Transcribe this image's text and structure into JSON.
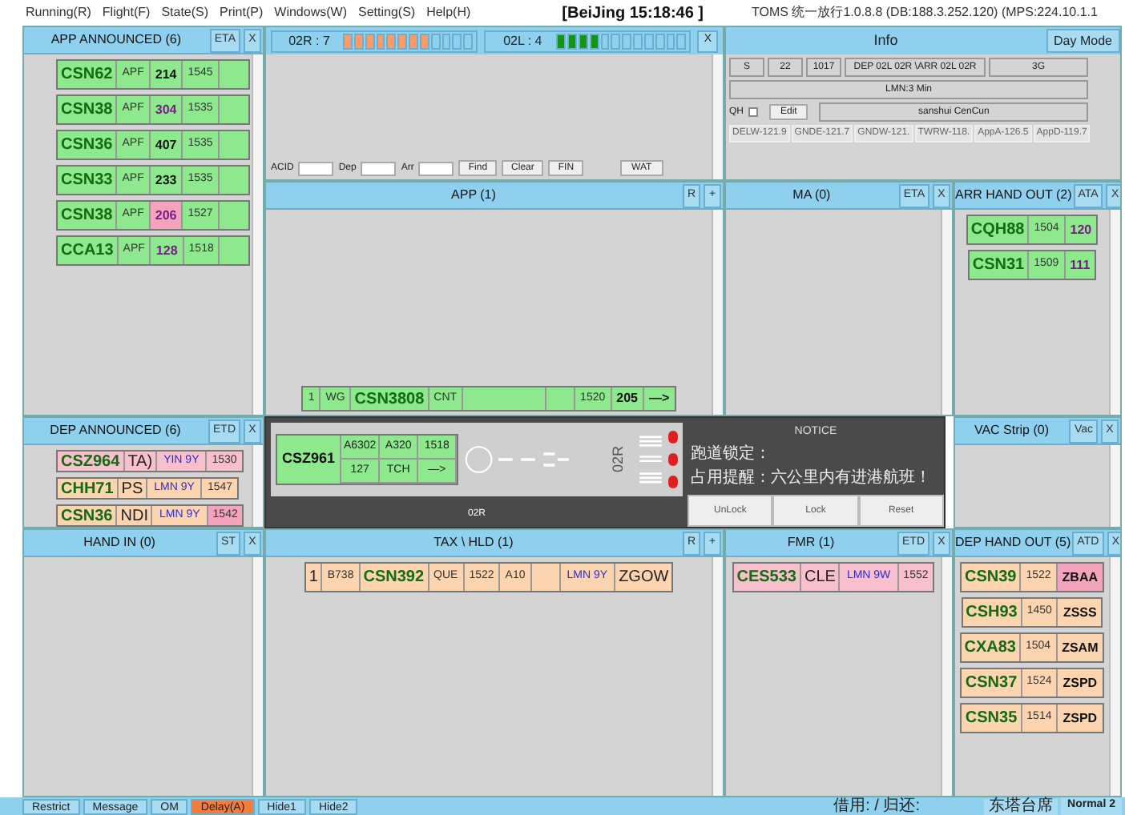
{
  "menu": [
    "Running(R)",
    "Flight(F)",
    "State(S)",
    "Print(P)",
    "Windows(W)",
    "Setting(S)",
    "Help(H)"
  ],
  "clock": "[BeiJing 15:18:46 ]",
  "version": "TOMS 统一放行1.0.8.8 (DB:188.3.252.120) (MPS:224.10.1.1",
  "app_announced": {
    "title": "APP ANNOUNCED (6)",
    "buttons": [
      "ETA",
      "X"
    ],
    "strips": [
      {
        "color": "#8ee88e",
        "cells": [
          {
            "text": "CSN62",
            "kind": "callsign"
          },
          {
            "text": "APF",
            "kind": "plain"
          },
          {
            "text": "214",
            "kind": "bold"
          },
          {
            "text": "1545",
            "kind": "plain"
          },
          {
            "kind": "gap"
          }
        ]
      },
      {
        "color": "#8ee88e",
        "cells": [
          {
            "text": "CSN38",
            "kind": "callsign"
          },
          {
            "text": "APF",
            "kind": "plain"
          },
          {
            "text": "304",
            "kind": "purple"
          },
          {
            "text": "1535",
            "kind": "plain"
          },
          {
            "kind": "gap"
          }
        ]
      },
      {
        "color": "#8ee88e",
        "cells": [
          {
            "text": "CSN36",
            "kind": "callsign"
          },
          {
            "text": "APF",
            "kind": "plain"
          },
          {
            "text": "407",
            "kind": "bold"
          },
          {
            "text": "1535",
            "kind": "plain"
          },
          {
            "kind": "gap"
          }
        ]
      },
      {
        "color": "#8ee88e",
        "cells": [
          {
            "text": "CSN33",
            "kind": "callsign"
          },
          {
            "text": "APF",
            "kind": "plain"
          },
          {
            "text": "233",
            "kind": "bold"
          },
          {
            "text": "1535",
            "kind": "plain"
          },
          {
            "kind": "gap"
          }
        ]
      },
      {
        "color": "#8ee88e",
        "cells": [
          {
            "text": "CSN38",
            "kind": "callsign"
          },
          {
            "text": "APF",
            "kind": "plain"
          },
          {
            "text": "206",
            "kind": "purple",
            "highlight": true
          },
          {
            "text": "1527",
            "kind": "plain"
          },
          {
            "kind": "gap"
          }
        ]
      },
      {
        "color": "#8ee88e",
        "cells": [
          {
            "text": "CCA13",
            "kind": "callsign"
          },
          {
            "text": "APF",
            "kind": "plain"
          },
          {
            "text": "128",
            "kind": "purple"
          },
          {
            "text": "1518",
            "kind": "plain"
          },
          {
            "kind": "gap"
          }
        ]
      }
    ]
  },
  "runways": [
    {
      "label": "02R : 7",
      "level": 0.636,
      "color": "#ff9966"
    },
    {
      "label": "02L : 4",
      "level": 0.308,
      "color": "#129612"
    }
  ],
  "runway_close": "X",
  "search": {
    "fields": [
      {
        "label": "ACID"
      },
      {
        "label": "Dep"
      },
      {
        "label": "Arr"
      }
    ],
    "buttons": [
      "Find",
      "Clear",
      "FIN"
    ],
    "extra_button": "WAT"
  },
  "info": {
    "title": "Info",
    "mode_button": "Day Mode",
    "values": [
      "S",
      "22",
      "1017",
      "DEP 02L 02R \\ARR 02L 02R",
      "3G"
    ],
    "notice": "LMN:3 Min",
    "qh_label": "QH",
    "qh_checked": false,
    "edit": "Edit",
    "location": "sanshui CenCun",
    "frequencies": [
      "DELW-121.9",
      "GNDE-121.7",
      "GNDW-121.",
      "TWRW-118.",
      "AppA-126.5",
      "AppD-119.7"
    ]
  },
  "app": {
    "title": "APP (1)",
    "buttons": [
      "R",
      "+"
    ],
    "strips": [
      {
        "color": "#8ee88e",
        "cells": [
          {
            "text": "1",
            "kind": "plain"
          },
          {
            "text": "WG",
            "kind": "plain"
          },
          {
            "text": "CSN3808",
            "kind": "callsign"
          },
          {
            "text": "CNT",
            "kind": "plain"
          },
          {
            "kind": "wide"
          },
          {
            "kind": "gap"
          },
          {
            "text": "1520",
            "kind": "plain"
          },
          {
            "text": "205",
            "kind": "bold"
          },
          {
            "text": "—>",
            "kind": "bold"
          }
        ]
      }
    ]
  },
  "ma": {
    "title": "MA (0)",
    "buttons": [
      "ETA",
      "X"
    ]
  },
  "arr_hand_out": {
    "title": "ARR HAND OUT (2)",
    "buttons": [
      "ATA",
      "X"
    ],
    "strips": [
      {
        "color": "#8ee88e",
        "cells": [
          {
            "text": "CQH88",
            "kind": "callsign"
          },
          {
            "text": "1504",
            "kind": "plain"
          },
          {
            "text": "120",
            "kind": "purple"
          }
        ]
      },
      {
        "color": "#8ee88e",
        "cells": [
          {
            "text": "CSN31",
            "kind": "callsign"
          },
          {
            "text": "1509",
            "kind": "plain"
          },
          {
            "text": "111",
            "kind": "purple"
          }
        ]
      }
    ]
  },
  "dep_announced": {
    "title": "DEP ANNOUNCED (6)",
    "buttons": [
      "ETD",
      "X"
    ],
    "strips": [
      {
        "color": "#f7c0cc",
        "cells": [
          {
            "text": "CSZ964",
            "kind": "callsign"
          },
          {
            "text": "TA)",
            "kind": "large"
          },
          {
            "text": "YIN 9Y",
            "kind": "blue"
          },
          {
            "text": "1530",
            "kind": "plain"
          }
        ]
      },
      {
        "color": "#fcd5b0",
        "cells": [
          {
            "text": "CHH71",
            "kind": "callsign"
          },
          {
            "text": "PS",
            "kind": "large"
          },
          {
            "text": "LMN 9Y",
            "kind": "blue"
          },
          {
            "text": "1547",
            "kind": "plain"
          }
        ]
      },
      {
        "color": "#fcd5b0",
        "cells": [
          {
            "text": "CSN36",
            "kind": "callsign"
          },
          {
            "text": "NDI",
            "kind": "large"
          },
          {
            "text": "LMN 9Y",
            "kind": "blue"
          },
          {
            "text": "1542",
            "kind": "plain",
            "highlight": true
          }
        ]
      }
    ]
  },
  "runway_dialog": {
    "callsign": "CSZ961",
    "color": "#8ee88e",
    "cells": [
      "A6302",
      "A320",
      "1518",
      "127",
      "TCH",
      "—>"
    ],
    "runway": "02R",
    "footer": "02R",
    "title": "NOTICE",
    "lines": [
      "跑道锁定：",
      "占用提醒：六公里内有进港航班！"
    ],
    "buttons": [
      "UnLock",
      "Lock",
      "Reset"
    ]
  },
  "vac": {
    "title": "VAC Strip (0)",
    "buttons": [
      "Vac",
      "X"
    ]
  },
  "hand_in": {
    "title": "HAND IN (0)",
    "buttons": [
      "ST",
      "X"
    ]
  },
  "tax": {
    "title": "TAX \\ HLD (1)",
    "buttons": [
      "R",
      "+"
    ],
    "strips": [
      {
        "color": "#fcd5b0",
        "cells": [
          {
            "text": "1",
            "kind": "large"
          },
          {
            "text": "B738",
            "kind": "plain"
          },
          {
            "text": "CSN392",
            "kind": "callsign"
          },
          {
            "text": "QUE",
            "kind": "plain"
          },
          {
            "text": "1522",
            "kind": "plain"
          },
          {
            "text": "A10",
            "kind": "plain"
          },
          {
            "kind": "gap"
          },
          {
            "text": "LMN 9Y",
            "kind": "blue"
          },
          {
            "text": "ZGOW",
            "kind": "large"
          }
        ]
      }
    ]
  },
  "fmr": {
    "title": "FMR (1)",
    "buttons": [
      "ETD",
      "X"
    ],
    "strips": [
      {
        "color": "#f7c0cc",
        "cells": [
          {
            "text": "CES533",
            "kind": "callsign"
          },
          {
            "text": "CLE",
            "kind": "large"
          },
          {
            "text": "LMN 9W",
            "kind": "blue"
          },
          {
            "text": "1552",
            "kind": "plain"
          }
        ]
      }
    ]
  },
  "dep_hand_out": {
    "title": "DEP HAND OUT (5)",
    "buttons": [
      "ATD",
      "X"
    ],
    "strips": [
      {
        "color": "#fcd5b0",
        "cells": [
          {
            "text": "CSN39",
            "kind": "callsign"
          },
          {
            "text": "1522",
            "kind": "plain"
          },
          {
            "text": "ZBAA",
            "kind": "bold",
            "highlight": true
          }
        ]
      },
      {
        "color": "#fcd5b0",
        "cells": [
          {
            "text": "CSH93",
            "kind": "callsign"
          },
          {
            "text": "1450",
            "kind": "plain"
          },
          {
            "text": "ZSSS",
            "kind": "bold"
          }
        ]
      },
      {
        "color": "#fcd5b0",
        "cells": [
          {
            "text": "CXA83",
            "kind": "callsign"
          },
          {
            "text": "1504",
            "kind": "plain"
          },
          {
            "text": "ZSAM",
            "kind": "bold"
          }
        ]
      },
      {
        "color": "#fcd5b0",
        "cells": [
          {
            "text": "CSN37",
            "kind": "callsign"
          },
          {
            "text": "1524",
            "kind": "plain"
          },
          {
            "text": "ZSPD",
            "kind": "bold"
          }
        ]
      },
      {
        "color": "#fcd5b0",
        "cells": [
          {
            "text": "CSN35",
            "kind": "callsign"
          },
          {
            "text": "1514",
            "kind": "plain"
          },
          {
            "text": "ZSPD",
            "kind": "bold"
          }
        ]
      }
    ]
  },
  "status_bar": {
    "buttons": [
      {
        "label": "Restrict",
        "alert": false
      },
      {
        "label": "Message",
        "alert": false
      },
      {
        "label": "OM",
        "alert": false
      },
      {
        "label": "Delay(A)",
        "alert": true
      },
      {
        "label": "Hide1",
        "alert": false
      },
      {
        "label": "Hide2",
        "alert": false
      }
    ],
    "handover": "借用: / 归还:",
    "position": "东塔台席",
    "mode": "Normal 2"
  }
}
